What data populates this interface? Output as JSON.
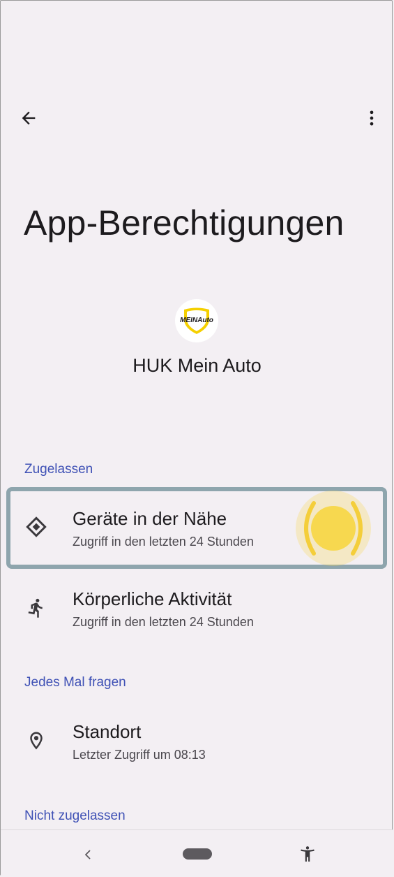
{
  "page": {
    "title": "App-Berechtigungen",
    "app_name": "HUK Mein Auto",
    "app_logo_text": "MEIN Auto"
  },
  "toolbar": {
    "back_icon": "arrow-back-icon",
    "menu_icon": "more-vert-icon"
  },
  "sections": {
    "allowed": {
      "header": "Zugelassen",
      "items": [
        {
          "icon": "nearby-devices-icon",
          "title": "Geräte in der Nähe",
          "subtitle": "Zugriff in den letzten 24 Stunden"
        },
        {
          "icon": "physical-activity-icon",
          "title": "Körperliche Aktivität",
          "subtitle": "Zugriff in den letzten 24 Stunden"
        }
      ]
    },
    "ask_every_time": {
      "header": "Jedes Mal fragen",
      "items": [
        {
          "icon": "location-icon",
          "title": "Standort",
          "subtitle": "Letzter Zugriff um 08:13"
        }
      ]
    },
    "denied": {
      "header": "Nicht zugelassen"
    }
  },
  "nav": {
    "back_icon": "nav-back-icon",
    "home_icon": "nav-home-pill",
    "accessibility_icon": "accessibility-icon"
  },
  "colors": {
    "background": "#f3eff3",
    "section_header": "#3f51b5",
    "highlight_border": "#8ea5ad",
    "tap_indicator": "#f7d84f",
    "logo_yellow": "#f5d000"
  }
}
